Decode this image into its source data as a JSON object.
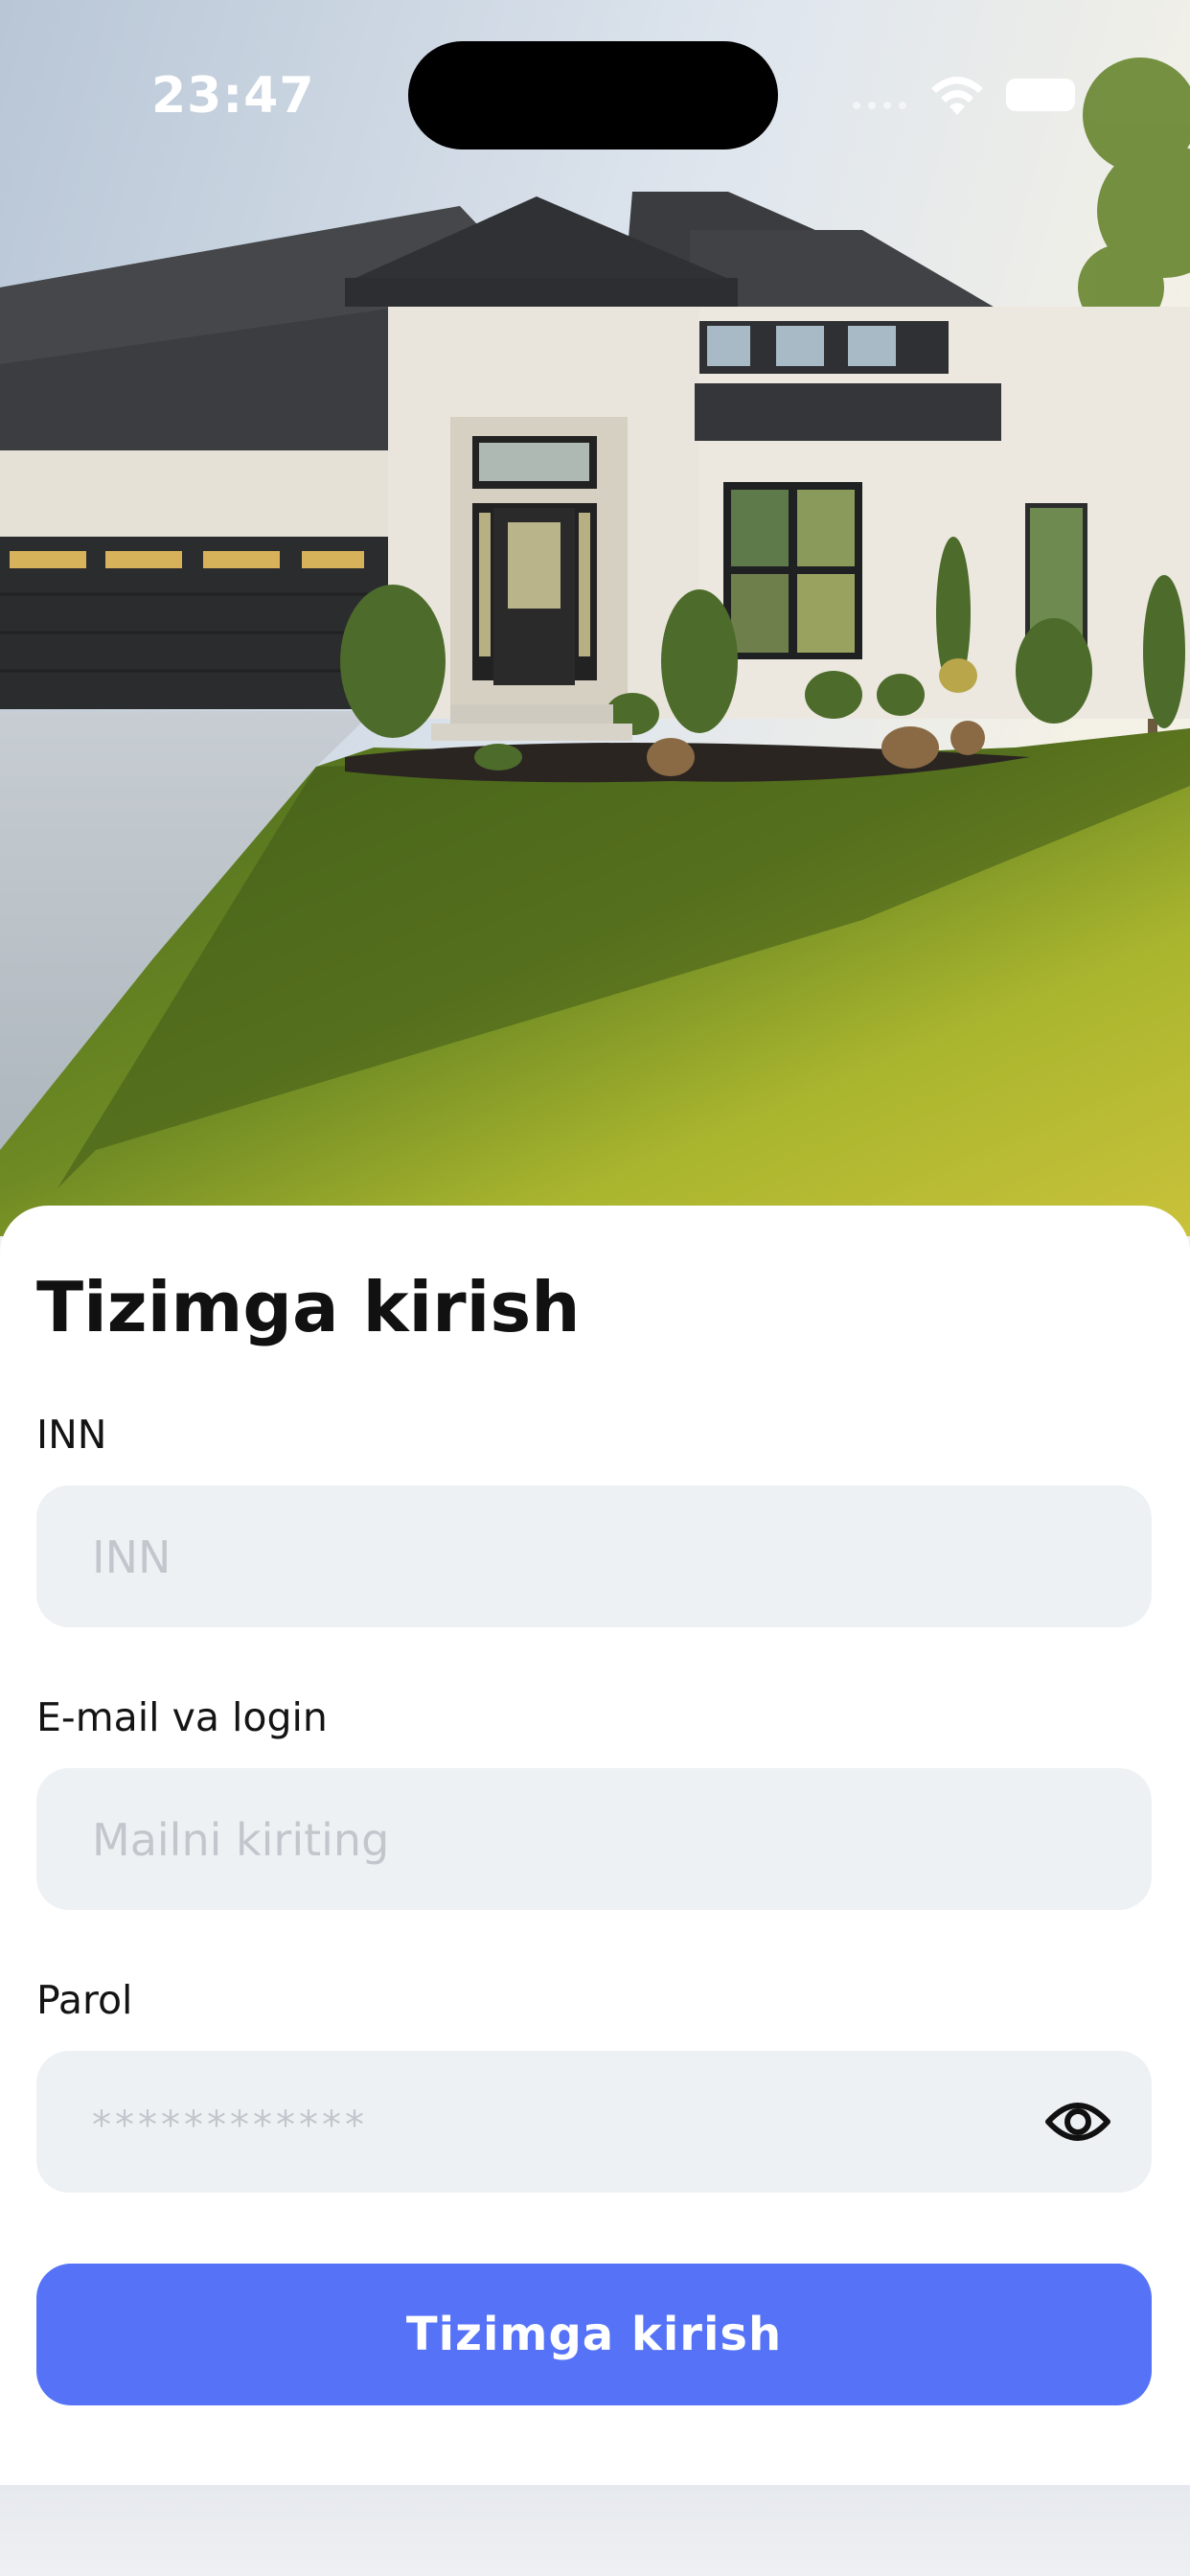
{
  "status_bar": {
    "time": "23:47"
  },
  "login": {
    "title": "Tizimga kirish",
    "inn_label": "INN",
    "inn_placeholder": "INN",
    "email_label": "E-mail va login",
    "email_placeholder": "Mailni kiriting",
    "password_label": "Parol",
    "password_placeholder": "************",
    "submit_label": "Tizimga kirish"
  },
  "colors": {
    "primary_button": "#5673f7",
    "input_background": "#eef1f4",
    "sheet_background": "#ffffff"
  },
  "icons": {
    "password_toggle": "eye-icon",
    "wifi": "wifi-icon",
    "battery": "battery-icon"
  }
}
